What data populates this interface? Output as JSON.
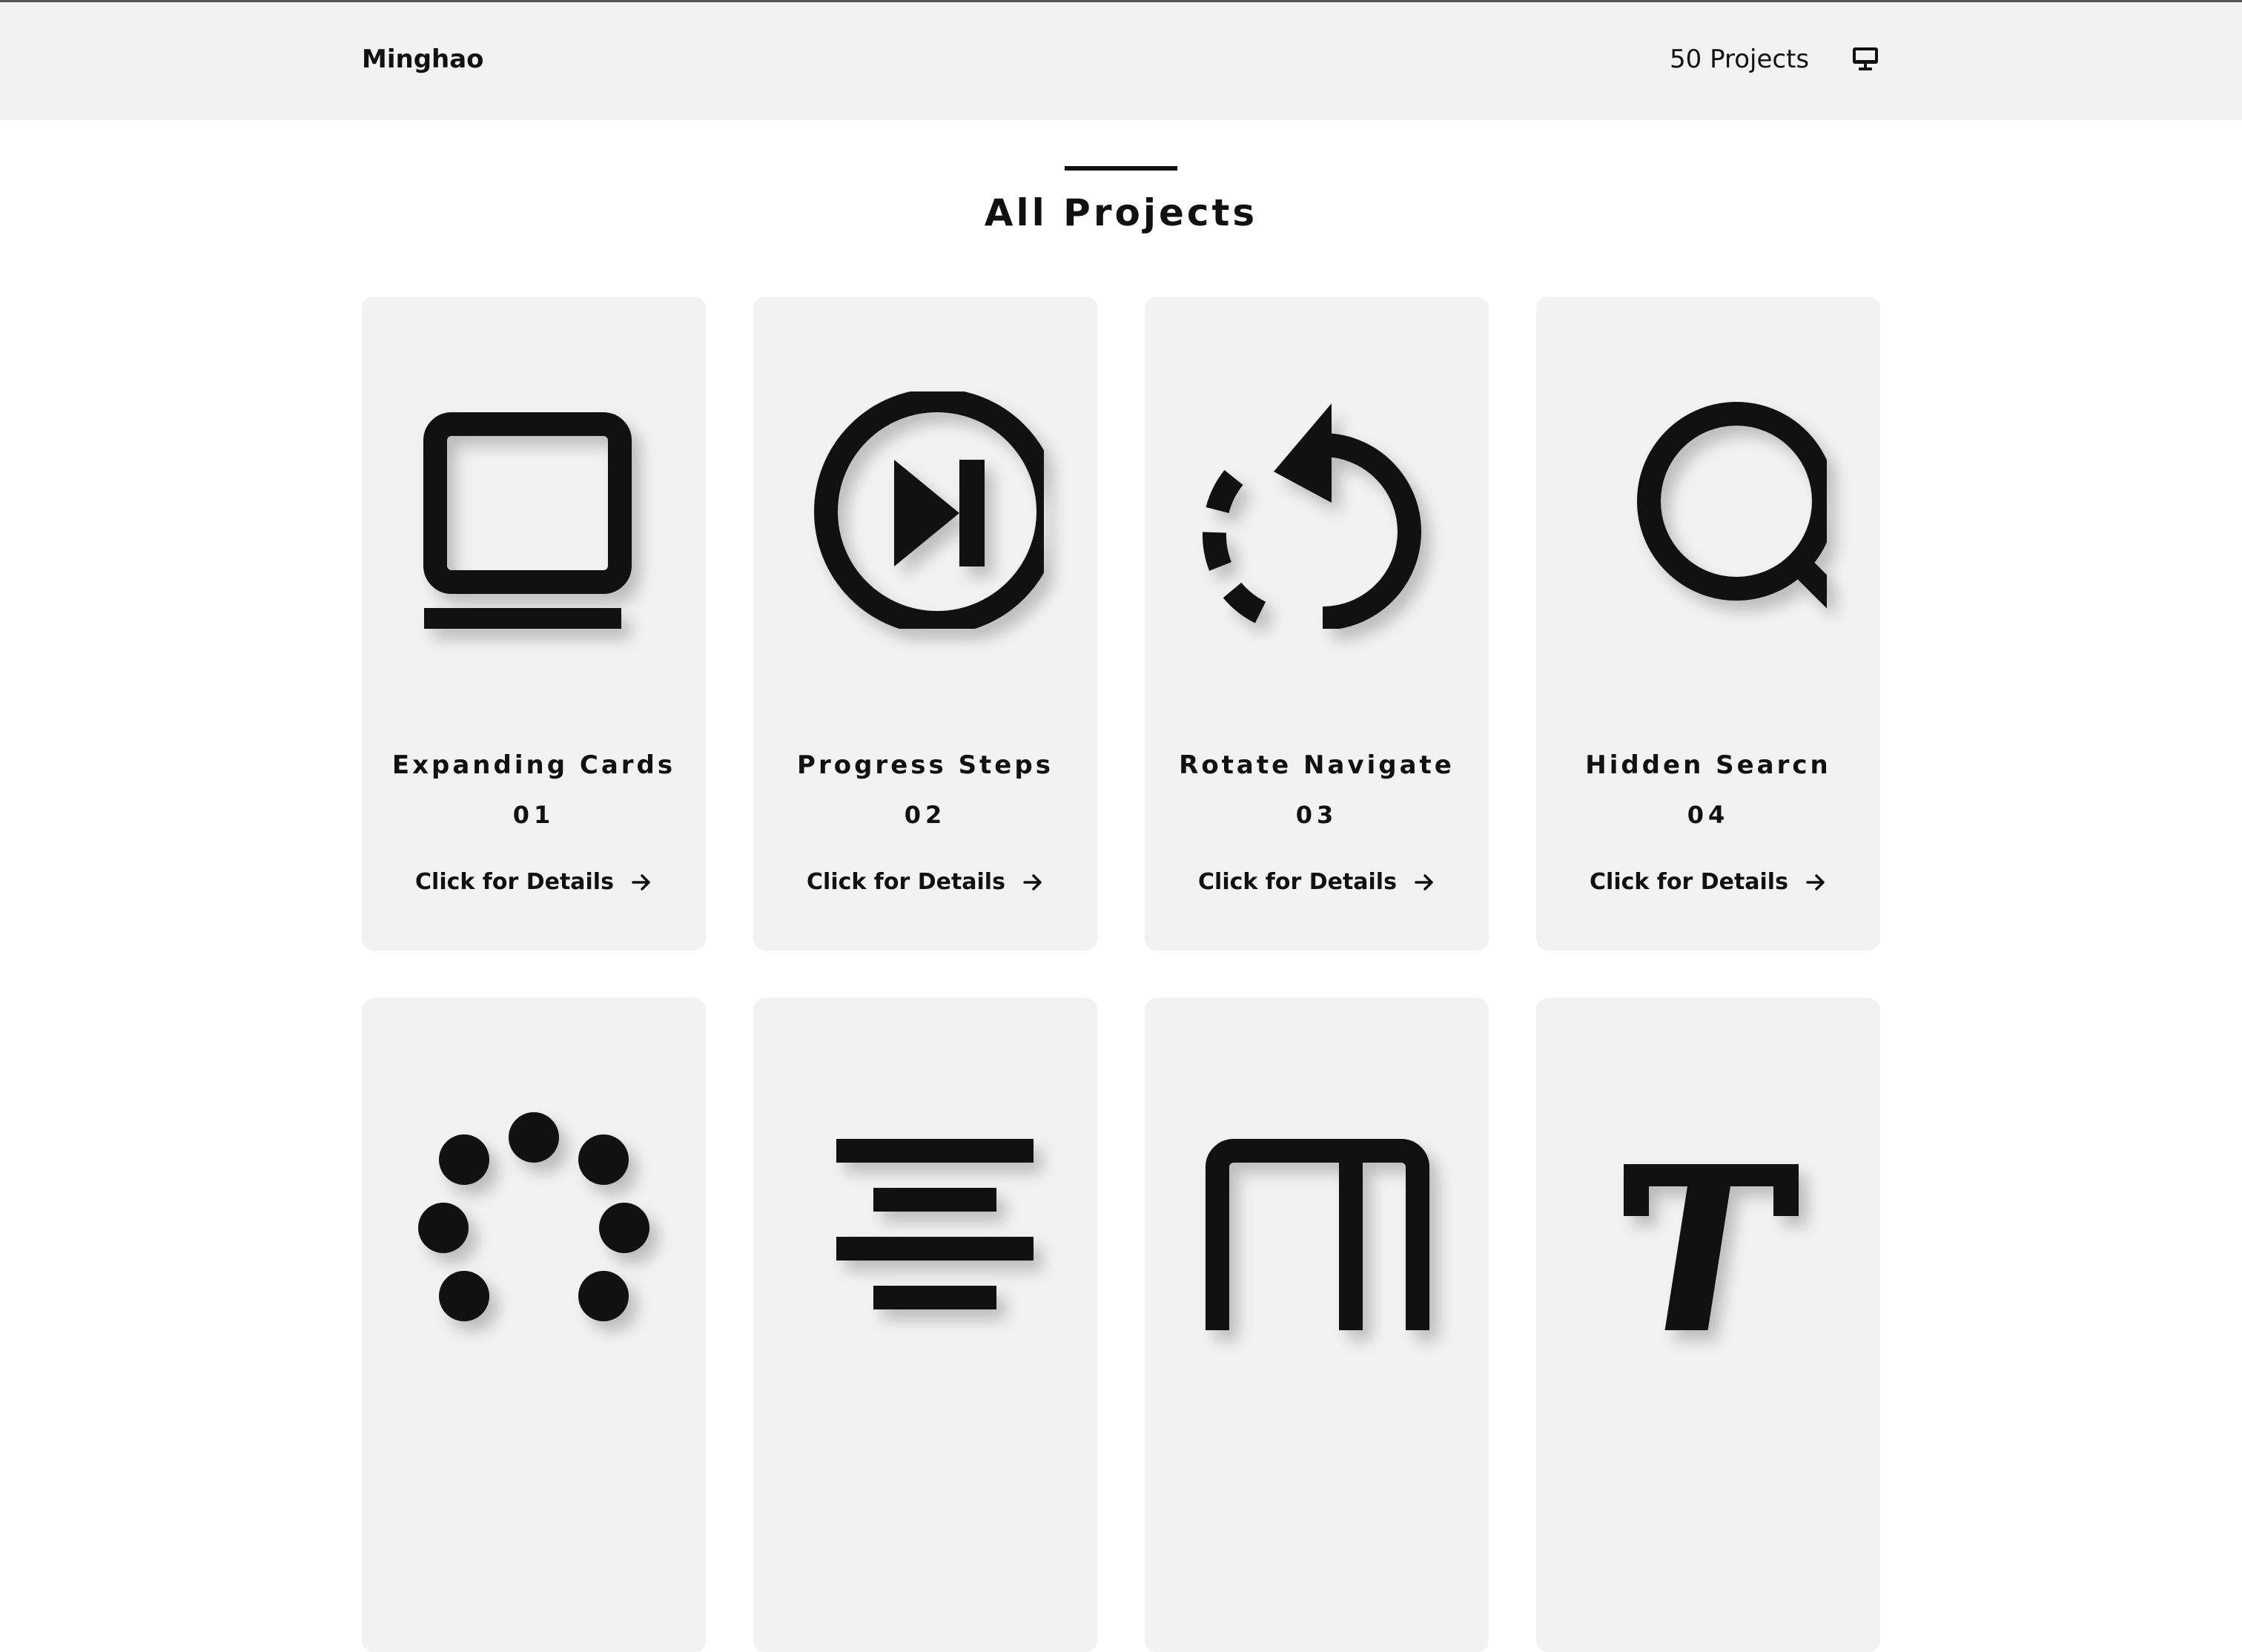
{
  "header": {
    "brand": "Minghao",
    "project_count": "50 Projects",
    "display_icon": "monitor-icon"
  },
  "main": {
    "title": "All Projects"
  },
  "cards": [
    {
      "name": "Expanding Cards",
      "number": "01",
      "details_label": "Click for Details",
      "icon": "laptop-icon"
    },
    {
      "name": "Progress Steps",
      "number": "02",
      "details_label": "Click for Details",
      "icon": "skip-next-circle-icon"
    },
    {
      "name": "Rotate Navigate",
      "number": "03",
      "details_label": "Click for Details",
      "icon": "rotate-dashed-icon"
    },
    {
      "name": "Hidden Searcn",
      "number": "04",
      "details_label": "Click for Details",
      "icon": "search-icon"
    },
    {
      "icon": "loading-dots-icon"
    },
    {
      "icon": "align-center-icon"
    },
    {
      "icon": "split-panel-icon"
    },
    {
      "icon": "text-t-icon"
    }
  ],
  "colors": {
    "background": "#ffffff",
    "panel": "#f2f2f2",
    "ink": "#111111"
  }
}
